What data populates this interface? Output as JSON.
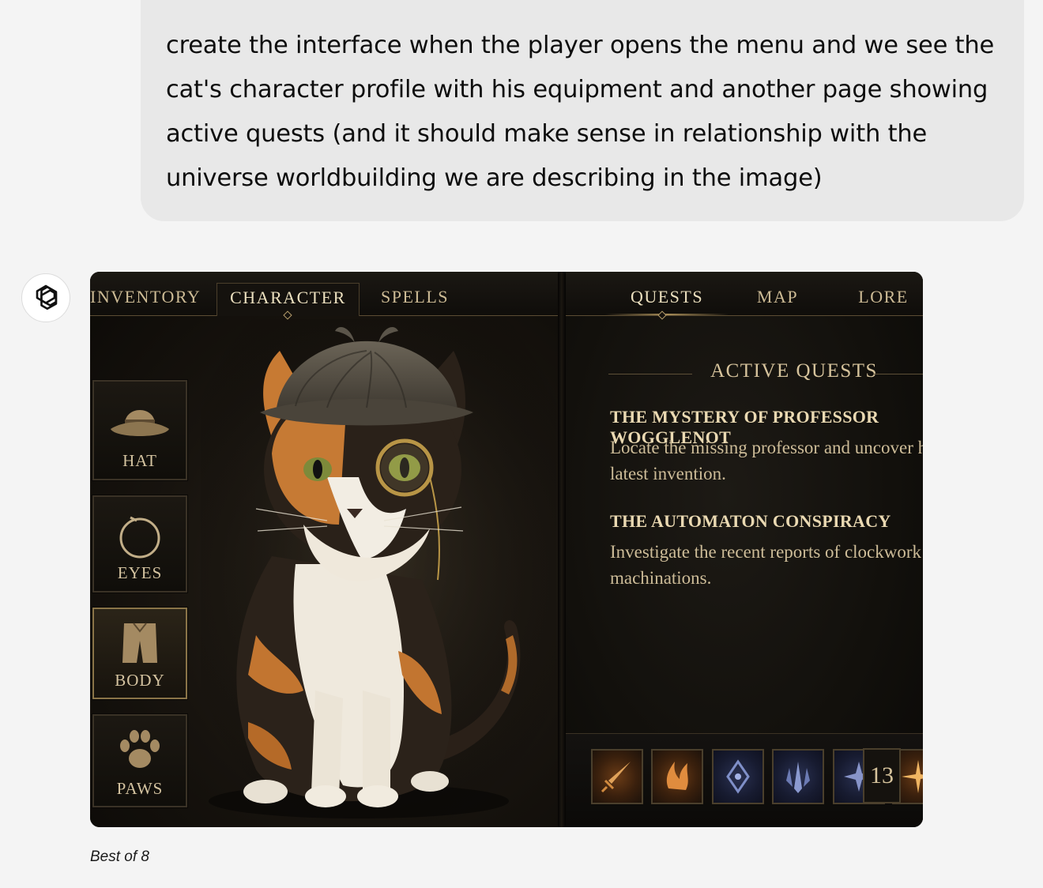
{
  "user_message": "create the interface when the player opens the menu and we see the cat's character profile with his equipment and another page showing active quests (and it should make sense in relationship with the universe worldbuilding we are describing in the image)",
  "assistant": {
    "avatar_icon": "openai-logo-icon",
    "caption": "Best of 8"
  },
  "game_ui": {
    "left_tabs": [
      {
        "label": "INVENTORY",
        "active": false
      },
      {
        "label": "CHARACTER",
        "active": true
      },
      {
        "label": "SPELLS",
        "active": false
      }
    ],
    "right_tabs": [
      {
        "label": "QUESTS",
        "active": true
      },
      {
        "label": "MAP",
        "active": false
      },
      {
        "label": "LORE",
        "active": false
      }
    ],
    "equipment_slots": [
      {
        "label": "HAT",
        "icon": "hat-icon",
        "active": false
      },
      {
        "label": "EYES",
        "icon": "monocle-icon",
        "active": false
      },
      {
        "label": "BODY",
        "icon": "cloak-icon",
        "active": true
      },
      {
        "label": "PAWS",
        "icon": "paw-icon",
        "active": false
      }
    ],
    "portrait": "calico-cat-deerstalker-monocle",
    "quests_heading": "ACTIVE QUESTS",
    "quests": [
      {
        "title": "THE MYSTERY OF PROFESSOR WOGGLENOT",
        "description": "Locate the missing professor and uncover his latest invention."
      },
      {
        "title": "THE AUTOMATON CONSPIRACY",
        "description": "Investigate the recent reports of clockwork machinations."
      }
    ],
    "skills": [
      {
        "icon": "dagger-icon",
        "tone": "warm"
      },
      {
        "icon": "flame-claw-icon",
        "tone": "warm"
      },
      {
        "icon": "diamond-rune-icon",
        "tone": "cool"
      },
      {
        "icon": "crystal-icon",
        "tone": "cool"
      },
      {
        "icon": "star-rune-icon",
        "tone": "cool"
      },
      {
        "icon": "sparkle-icon",
        "tone": "warm"
      }
    ],
    "skill_count": "13",
    "colors": {
      "gold_text": "#d6c39c",
      "panel_dark": "#12100c",
      "border_gold": "#8a7448"
    }
  }
}
